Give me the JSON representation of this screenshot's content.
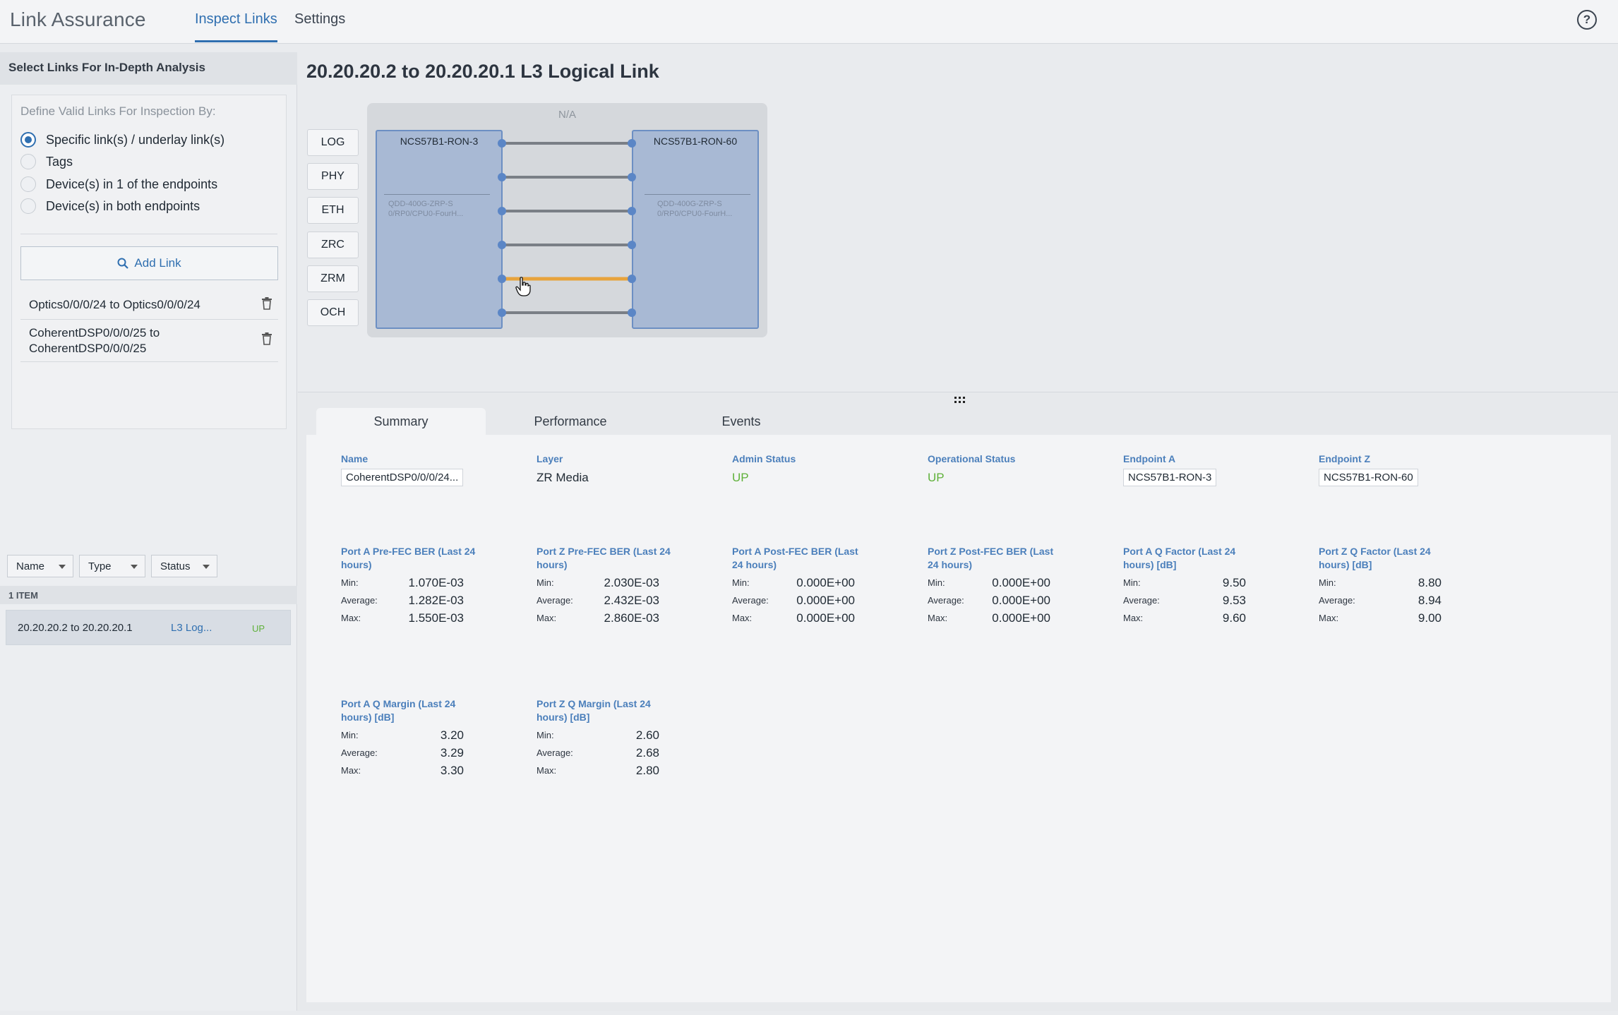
{
  "app": {
    "title": "Link Assurance",
    "tabs": [
      "Inspect Links",
      "Settings"
    ],
    "help_icon": "?"
  },
  "sidebar": {
    "header": "Select Links For In-Depth Analysis",
    "define_title": "Define Valid Links For Inspection By:",
    "options": [
      {
        "label": "Specific link(s) / underlay link(s)",
        "checked": true
      },
      {
        "label": "Tags",
        "checked": false
      },
      {
        "label": "Device(s) in 1 of the endpoints",
        "checked": false
      },
      {
        "label": "Device(s) in both endpoints",
        "checked": false
      }
    ],
    "add_link": "Add Link",
    "links": [
      {
        "line1": "Optics0/0/0/24 to Optics0/0/0/24",
        "line2": ""
      },
      {
        "line1": "CoherentDSP0/0/0/25 to",
        "line2": "CoherentDSP0/0/0/25"
      }
    ],
    "filters": [
      "Name",
      "Type",
      "Status"
    ],
    "item_count": "1 ITEM",
    "results": [
      {
        "name": "20.20.20.2 to 20.20.20.1",
        "type": "L3 Log...",
        "status": "UP"
      }
    ]
  },
  "main": {
    "title": "20.20.20.2 to 20.20.20.1 L3 Logical Link",
    "layers": [
      "LOG",
      "PHY",
      "ETH",
      "ZRC",
      "ZRM",
      "OCH"
    ],
    "topology": {
      "na_label": "N/A",
      "device_a": {
        "name": "NCS57B1-RON-3",
        "port1": "QDD-400G-ZRP-S",
        "port2": "0/RP0/CPU0-FourH..."
      },
      "device_z": {
        "name": "NCS57B1-RON-60",
        "port1": "QDD-400G-ZRP-S",
        "port2": "0/RP0/CPU0-FourH..."
      },
      "highlight_layer": "ZRM",
      "highlight_color": "#e8a33c",
      "link_color": "#7a7f86",
      "node_color": "#5b86c6"
    },
    "detail_tabs": [
      "Summary",
      "Performance",
      "Events"
    ],
    "summary": {
      "name_label": "Name",
      "name_value": "CoherentDSP0/0/0/24...",
      "layer_label": "Layer",
      "layer_value": "ZR Media",
      "admin_label": "Admin Status",
      "admin_value": "UP",
      "oper_label": "Operational Status",
      "oper_value": "UP",
      "endpoint_a_label": "Endpoint A",
      "endpoint_a_value": "NCS57B1-RON-3",
      "endpoint_z_label": "Endpoint Z",
      "endpoint_z_value": "NCS57B1-RON-60"
    },
    "metric_keys": [
      "Min:",
      "Average:",
      "Max:"
    ],
    "metrics": [
      {
        "title1": "Port A Pre-FEC BER (Last 24",
        "title2": "hours)",
        "min": "1.070E-03",
        "avg": "1.282E-03",
        "max": "1.550E-03"
      },
      {
        "title1": "Port Z Pre-FEC BER (Last 24",
        "title2": "hours)",
        "min": "2.030E-03",
        "avg": "2.432E-03",
        "max": "2.860E-03"
      },
      {
        "title1": "Port A Post-FEC BER (Last",
        "title2": "24 hours)",
        "min": "0.000E+00",
        "avg": "0.000E+00",
        "max": "0.000E+00"
      },
      {
        "title1": "Port Z Post-FEC BER (Last",
        "title2": "24 hours)",
        "min": "0.000E+00",
        "avg": "0.000E+00",
        "max": "0.000E+00"
      },
      {
        "title1": "Port A Q Factor (Last 24",
        "title2": "hours) [dB]",
        "min": "9.50",
        "avg": "9.53",
        "max": "9.60"
      },
      {
        "title1": "Port Z Q Factor (Last 24",
        "title2": "hours) [dB]",
        "min": "8.80",
        "avg": "8.94",
        "max": "9.00"
      },
      {
        "title1": "Port A Q Margin (Last 24",
        "title2": "hours) [dB]",
        "min": "3.20",
        "avg": "3.29",
        "max": "3.30"
      },
      {
        "title1": "Port Z Q Margin (Last 24",
        "title2": "hours) [dB]",
        "min": "2.60",
        "avg": "2.68",
        "max": "2.80"
      }
    ]
  }
}
